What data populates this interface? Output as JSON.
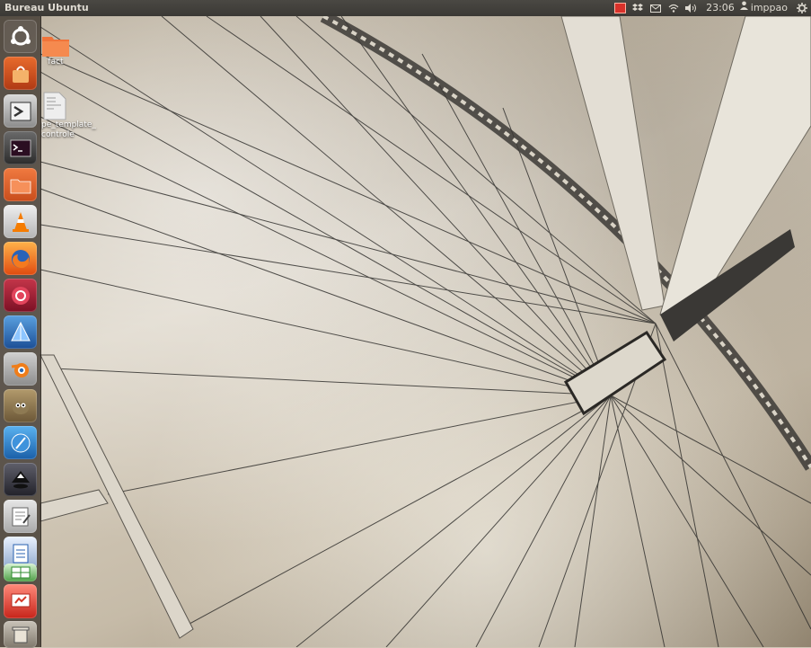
{
  "panel": {
    "title": "Bureau Ubuntu",
    "clock": "23:06",
    "user": "imppao",
    "indicators": [
      "notification-icon",
      "dropbox-icon",
      "mail-icon",
      "wifi-icon",
      "volume-icon"
    ]
  },
  "launcher": {
    "items": [
      {
        "name": "dash-home",
        "icon": "ubuntu-logo-icon"
      },
      {
        "name": "software-center",
        "icon": "shopping-bag-icon"
      },
      {
        "name": "remote-terminal",
        "icon": "terminal-arrow-icon"
      },
      {
        "name": "terminal",
        "icon": "terminal-icon"
      },
      {
        "name": "files",
        "icon": "folder-icon"
      },
      {
        "name": "vlc",
        "icon": "traffic-cone-icon"
      },
      {
        "name": "firefox",
        "icon": "firefox-icon"
      },
      {
        "name": "app-red",
        "icon": "red-circle-icon"
      },
      {
        "name": "app-blue",
        "icon": "pyramid-icon"
      },
      {
        "name": "blender",
        "icon": "blender-icon"
      },
      {
        "name": "gimp",
        "icon": "gimp-icon"
      },
      {
        "name": "globe-app",
        "icon": "globe-icon"
      },
      {
        "name": "inkscape",
        "icon": "inkscape-icon"
      },
      {
        "name": "text-editor",
        "icon": "text-editor-icon"
      },
      {
        "name": "libreoffice-writer",
        "icon": "document-icon"
      },
      {
        "name": "libreoffice-calc",
        "icon": "spreadsheet-icon"
      },
      {
        "name": "libreoffice-impress",
        "icon": "presentation-icon"
      },
      {
        "name": "trash",
        "icon": "trash-icon"
      }
    ]
  },
  "desktop": {
    "icons": [
      {
        "label": "fact",
        "icon": "folder-icon"
      },
      {
        "label": "pe_template_controle",
        "icon": "text-file-icon"
      }
    ]
  },
  "colors": {
    "panel_bg": "#3b3935",
    "launcher_bg": "#3a322a",
    "wallpaper_tone": "#c6bba8"
  }
}
